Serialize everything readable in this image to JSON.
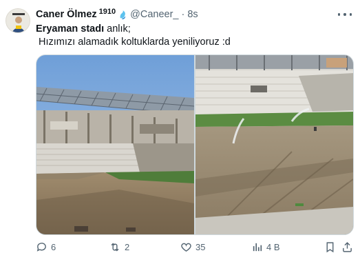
{
  "tweet": {
    "author": {
      "display_name": "Caner Ölmez",
      "display_suffix": "1910",
      "handle": "@Caneer_",
      "separator": "·",
      "time": "8s",
      "avatar_icon": "profile-avatar",
      "verified_icon": "water-drop-emoji-icon"
    },
    "text": {
      "bold_part": "Eryaman stadı",
      "line1_rest": " anlık;",
      "line2": " Hızımızı alamadık koltuklarda yeniliyoruz :d"
    },
    "media": [
      {
        "icon": "stadium-photo-left"
      },
      {
        "icon": "stadium-photo-right"
      }
    ],
    "actions": {
      "replies": "6",
      "retweets": "2",
      "likes": "35",
      "views": "4 B"
    },
    "colors": {
      "text_primary": "#0f1419",
      "text_secondary": "#536471",
      "border": "#cfd9de"
    }
  }
}
